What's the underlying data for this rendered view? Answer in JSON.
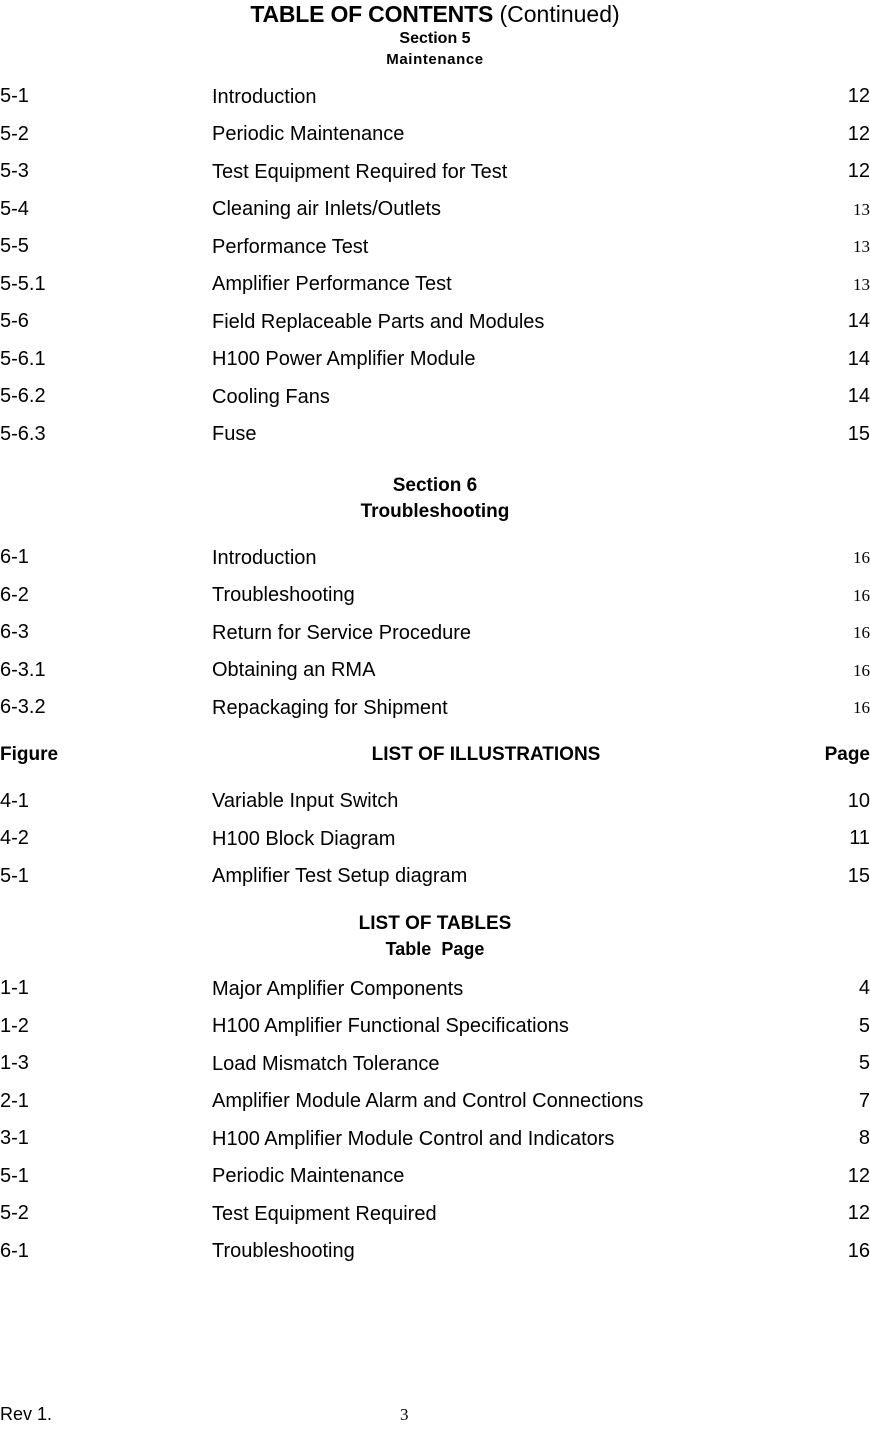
{
  "document": {
    "title_main": "TABLE OF CONTENTS",
    "title_suffix": " (Continued)"
  },
  "section5": {
    "heading": "Section 5",
    "subheading": "Maintenance",
    "entries": [
      {
        "number": "5-1",
        "title": "Introduction",
        "page": "12",
        "style": "sans"
      },
      {
        "number": "5-2",
        "title": "Periodic Maintenance",
        "page": "12",
        "style": "sans"
      },
      {
        "number": "5-3",
        "title": "Test Equipment Required for Test",
        "page": "12",
        "style": "sans"
      },
      {
        "number": "5-4",
        "title": "Cleaning air Inlets/Outlets",
        "page": "13",
        "style": "serif"
      },
      {
        "number": "5-5",
        "title": "Performance Test",
        "page": "13",
        "style": "serif"
      },
      {
        "number": "5-5.1",
        "title": "Amplifier Performance Test",
        "page": "13",
        "style": "serif"
      },
      {
        "number": "5-6",
        "title": "Field Replaceable Parts and Modules",
        "page": "14",
        "style": "sans"
      },
      {
        "number": "5-6.1",
        "title": "H100 Power Amplifier Module",
        "page": "14",
        "style": "sans"
      },
      {
        "number": "5-6.2",
        "title": "Cooling Fans",
        "page": "14",
        "style": "sans"
      },
      {
        "number": "5-6.3",
        "title": "Fuse",
        "page": "15",
        "style": "sans"
      }
    ]
  },
  "section6": {
    "heading": "Section 6",
    "subheading": "Troubleshooting",
    "entries": [
      {
        "number": "6-1",
        "title": "Introduction",
        "page": "16",
        "style": "serif"
      },
      {
        "number": "6-2",
        "title": "Troubleshooting",
        "page": "16",
        "style": "serif"
      },
      {
        "number": "6-3",
        "title": "Return for Service Procedure",
        "page": "16",
        "style": "serif"
      },
      {
        "number": "6-3.1",
        "title": "Obtaining an RMA",
        "page": "16",
        "style": "serif"
      },
      {
        "number": "6-3.2",
        "title": "Repackaging for Shipment",
        "page": "16",
        "style": "serif"
      }
    ]
  },
  "illustrations": {
    "col_left_label": "Figure",
    "heading": "LIST OF ILLUSTRATIONS",
    "col_right_label": "Page",
    "entries": [
      {
        "number": "4-1",
        "title": "Variable Input Switch",
        "page": "10",
        "style": "sans"
      },
      {
        "number": "4-2",
        "title": "H100 Block Diagram",
        "page": "11",
        "style": "sans"
      },
      {
        "number": "5-1",
        "title": "Amplifier Test Setup diagram",
        "page": "15",
        "style": "sans"
      }
    ]
  },
  "tables": {
    "heading": "LIST OF TABLES",
    "subheading": "Table  Page",
    "entries": [
      {
        "number": "1-1",
        "title": "Major Amplifier Components",
        "page": "4",
        "style": "sans"
      },
      {
        "number": "1-2",
        "title": "H100 Amplifier Functional Specifications",
        "page": "5",
        "style": "sans"
      },
      {
        "number": "1-3",
        "title": "Load Mismatch Tolerance",
        "page": "5",
        "style": "sans"
      },
      {
        "number": "2-1",
        "title": "Amplifier Module Alarm and Control Connections",
        "page": "7",
        "style": "sans"
      },
      {
        "number": "3-1",
        "title": "H100 Amplifier Module Control and Indicators",
        "page": "8",
        "style": "sans"
      },
      {
        "number": "5-1",
        "title": "Periodic Maintenance",
        "page": "12",
        "style": "sans"
      },
      {
        "number": "5-2",
        "title": "Test Equipment Required",
        "page": "12",
        "style": "sans"
      },
      {
        "number": "6-1",
        "title": "Troubleshooting",
        "page": "16",
        "style": "sans"
      }
    ]
  },
  "footer": {
    "revision": "Rev 1.",
    "page_number": "3"
  }
}
